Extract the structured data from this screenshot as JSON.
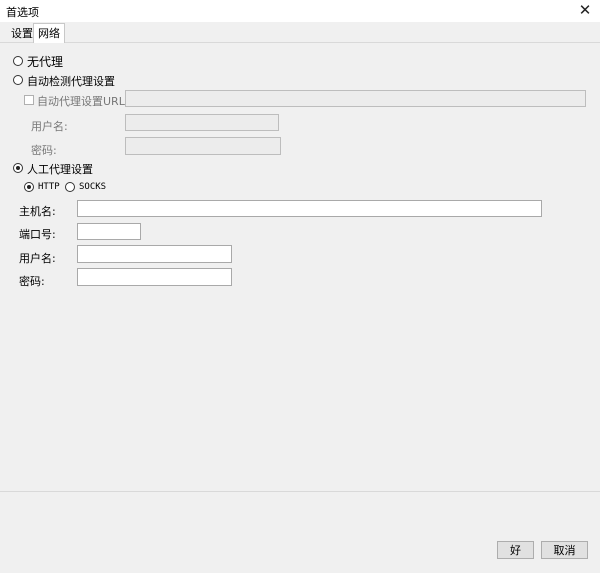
{
  "window": {
    "title": "首选项",
    "close_glyph": "✕"
  },
  "tabs": [
    {
      "label": "设置"
    },
    {
      "label": "网络"
    }
  ],
  "proxy": {
    "no_proxy_label": "无代理",
    "auto_detect_label": "自动检测代理设置",
    "auto_config_url_label": "自动代理设置URL:",
    "auto_username_label": "用户名:",
    "auto_password_label": "密码:",
    "manual_label": "人工代理设置",
    "http_label": "HTTP",
    "socks_label": "SOCKS",
    "host_label": "主机名:",
    "port_label": "端口号:",
    "username_label": "用户名:",
    "password_label": "密码:",
    "selected_mode": "manual",
    "selected_protocol": "HTTP",
    "auto_config_url_value": "",
    "auto_username_value": "",
    "auto_password_value": "",
    "host_value": "",
    "port_value": "",
    "username_value": "",
    "password_value": ""
  },
  "buttons": {
    "ok_label": "好",
    "cancel_label": "取消"
  }
}
